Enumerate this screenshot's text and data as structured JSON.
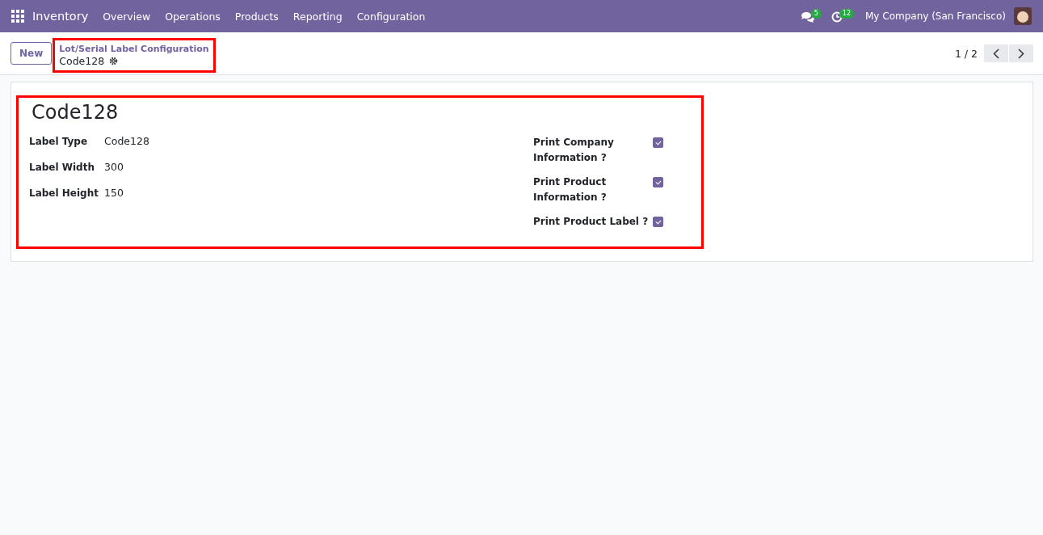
{
  "navbar": {
    "app": "Inventory",
    "menu": [
      "Overview",
      "Operations",
      "Products",
      "Reporting",
      "Configuration"
    ],
    "messages_count": "5",
    "activities_count": "12",
    "company": "My Company (San Francisco)"
  },
  "control_panel": {
    "new_button": "New",
    "breadcrumb": "Lot/Serial Label Configuration",
    "record": "Code128",
    "pager": "1 / 2"
  },
  "form": {
    "title": "Code128",
    "left_fields": [
      {
        "label": "Label Type",
        "value": "Code128"
      },
      {
        "label": "Label Width",
        "value": "300"
      },
      {
        "label": "Label Height",
        "value": "150"
      }
    ],
    "right_fields": [
      {
        "label": "Print Company Information ?",
        "checked": true
      },
      {
        "label": "Print Product Information ?",
        "checked": true
      },
      {
        "label": "Print Product Label ?",
        "checked": true
      }
    ]
  }
}
